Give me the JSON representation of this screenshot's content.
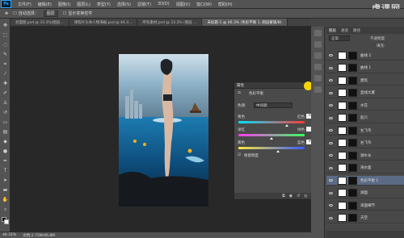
{
  "app": {
    "logo": "Ps",
    "watermark": "虎课网"
  },
  "menu": [
    "文件(F)",
    "编辑(E)",
    "图像(I)",
    "图层(L)",
    "类型(Y)",
    "选择(S)",
    "滤镜(T)",
    "3D(D)",
    "视图(V)",
    "窗口(W)",
    "帮助(H)"
  ],
  "options": {
    "auto_select": "自动选择：",
    "target": "图层",
    "show_controls": "显示变换控件"
  },
  "tabs": [
    "封面图.psd @ 33.3%(图层...",
    "课程片头体人物海报.psd @ 44.4...",
    "所有素材.psd @ 33.3% (图层 ...",
    "未标题-1 @ 46.3% (色彩平衡 1, 图层蒙版/8)"
  ],
  "status": {
    "zoom": "46.31%",
    "doc": "文档:2.75M/46.8M"
  },
  "properties": {
    "title": "属性",
    "adj_label": "色彩平衡",
    "tone_label": "色调:",
    "tone_value": "中间调",
    "sliders": [
      {
        "left": "青色",
        "right": "红色",
        "value": "+35",
        "fraction": 0.73
      },
      {
        "left": "洋红",
        "right": "绿色",
        "value": "0",
        "fraction": 0.5
      },
      {
        "left": "黄色",
        "right": "蓝色",
        "value": "+15",
        "fraction": 0.6
      }
    ],
    "preserve_label": "保留明度"
  },
  "layers": {
    "tabs": [
      "图层",
      "通道",
      "路径"
    ],
    "blend_mode": "正常",
    "opacity_label": "不透明度:",
    "fill_label": "填充:",
    "items": [
      "曲线 2",
      "曲线 1",
      "建筑",
      "直线大厦",
      "水花",
      "船只",
      "左飞鸟",
      "右飞鸟",
      "湖水长",
      "海水面",
      "色彩平衡 1",
      "湖面",
      "海面细节",
      "天空"
    ],
    "selected_index": 10
  }
}
